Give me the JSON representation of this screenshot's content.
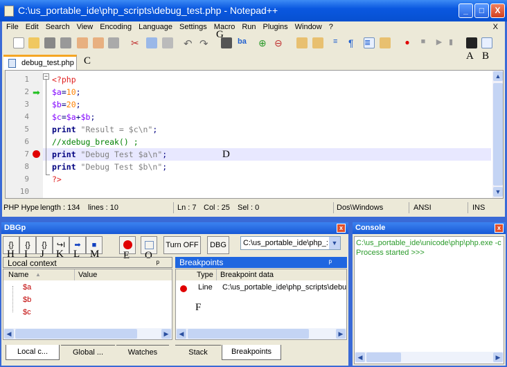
{
  "window": {
    "title": "C:\\us_portable_ide\\php_scripts\\debug_test.php - Notepad++",
    "minimize": "_",
    "maximize": "□",
    "close": "X"
  },
  "menu": [
    "File",
    "Edit",
    "Search",
    "View",
    "Encoding",
    "Language",
    "Settings",
    "Macro",
    "Run",
    "Plugins",
    "Window",
    "?"
  ],
  "menu_close": "X",
  "tab": {
    "label": "debug_test.php"
  },
  "editor": {
    "line_numbers": [
      "1",
      "2",
      "3",
      "4",
      "5",
      "6",
      "7",
      "8",
      "9",
      "10"
    ],
    "lines": [
      [
        [
          "<?php",
          "#e02020"
        ]
      ],
      [
        [
          "$a",
          "#8000ff"
        ],
        [
          "=",
          "#000080"
        ],
        [
          "10",
          "#ff8000"
        ],
        [
          ";",
          "#000080"
        ]
      ],
      [
        [
          "$b",
          "#8000ff"
        ],
        [
          "=",
          "#000080"
        ],
        [
          "20",
          "#ff8000"
        ],
        [
          ";",
          "#000080"
        ]
      ],
      [
        [
          "$c",
          "#8000ff"
        ],
        [
          "=",
          "#000080"
        ],
        [
          "$a",
          "#8000ff"
        ],
        [
          "+",
          "#000080"
        ],
        [
          "$b",
          "#8000ff"
        ],
        [
          ";",
          "#000080"
        ]
      ],
      [
        [
          "print",
          "#000080b"
        ],
        [
          " \"Result = $c\\n\"",
          "#808080"
        ],
        [
          ";",
          "#000080"
        ]
      ],
      [
        [
          "//xdebug_break() ;",
          "#008000"
        ]
      ],
      [
        [
          "print",
          "#000080b"
        ],
        [
          " \"Debug Test $a\\n\"",
          "#808080"
        ],
        [
          ";",
          "#000080"
        ]
      ],
      [
        [
          "print",
          "#000080b"
        ],
        [
          " \"Debug Test $b\\n\"",
          "#808080"
        ],
        [
          ";",
          "#000080"
        ]
      ],
      [
        [
          "?>",
          "#e02020"
        ]
      ],
      []
    ],
    "current_line": 7,
    "breakpoint_line": 7,
    "execution_line": 2
  },
  "status": {
    "lang": "PHP Hype",
    "length": "length : 134",
    "lines": "lines : 10",
    "ln": "Ln : 7",
    "col": "Col : 25",
    "sel": "Sel : 0",
    "eol": "Dos\\Windows",
    "enc": "ANSI",
    "mode": "INS"
  },
  "dbgp": {
    "title": "DBGp",
    "buttons": [
      "{}",
      "{}",
      "{}",
      "↪I",
      "➡",
      "■"
    ],
    "turn_off": "Turn OFF",
    "dbg": "DBG",
    "path_select": "C:\\us_portable_ide\\php_:",
    "local_context": "Local context",
    "pin": "ᵖ",
    "columns": [
      "Name",
      "Value"
    ],
    "vars": [
      "$a",
      "$b",
      "$c"
    ],
    "breakpoints_title": "Breakpoints",
    "bp_columns": [
      "Type",
      "Breakpoint data"
    ],
    "bp_rows": [
      {
        "type": "Line",
        "data": "C:\\us_portable_ide\\php_scripts\\debu"
      }
    ],
    "left_tabs": [
      "Local c...",
      "Global ...",
      "Watches"
    ],
    "right_tabs": [
      "Stack",
      "Breakpoints"
    ]
  },
  "console": {
    "title": "Console",
    "lines": [
      "C:\\us_portable_ide\\unicode\\php\\php.exe -c",
      "Process started >>>"
    ]
  },
  "annotations": {
    "A": "A",
    "B": "B",
    "C": "C",
    "D": "D",
    "E": "E",
    "F": "F",
    "G": "G",
    "H": "H",
    "I": "I",
    "J": "J",
    "K": "K",
    "L": "L",
    "M": "M",
    "O": "O"
  }
}
